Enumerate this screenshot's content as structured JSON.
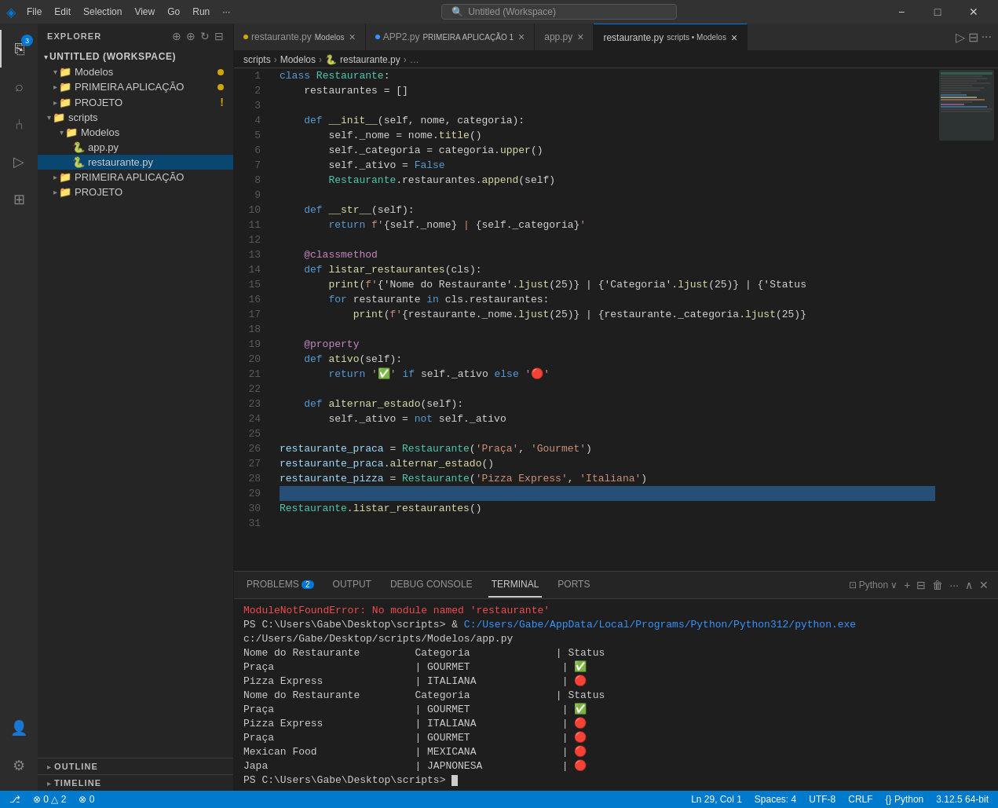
{
  "titlebar": {
    "logo": "◈",
    "menu_items": [
      "File",
      "Edit",
      "Selection",
      "View",
      "Go",
      "Run",
      "···"
    ],
    "search_placeholder": "Untitled (Workspace)",
    "controls": [
      "⧉",
      "⊡",
      "❐",
      "⊞",
      "−",
      "□",
      "✕"
    ]
  },
  "activity_bar": {
    "icons": [
      {
        "name": "explorer-icon",
        "symbol": "⎘",
        "badge": "3",
        "has_badge": true
      },
      {
        "name": "search-icon",
        "symbol": "🔍",
        "has_badge": false
      },
      {
        "name": "source-control-icon",
        "symbol": "⑃",
        "has_badge": false
      },
      {
        "name": "run-icon",
        "symbol": "▷",
        "has_badge": false
      },
      {
        "name": "extensions-icon",
        "symbol": "⊞",
        "has_badge": false
      }
    ],
    "bottom_icons": [
      {
        "name": "account-icon",
        "symbol": "👤"
      },
      {
        "name": "settings-icon",
        "symbol": "⚙"
      }
    ]
  },
  "sidebar": {
    "title": "EXPLORER",
    "workspace": "UNTITLED (WORKSPACE)",
    "tree": [
      {
        "label": "Modelos",
        "indent": 1,
        "type": "folder",
        "expanded": true,
        "dot": "yellow"
      },
      {
        "label": "PRIMEIRA APLICAÇÃO",
        "indent": 1,
        "type": "folder",
        "expanded": false,
        "dot": "yellow"
      },
      {
        "label": "PROJETO",
        "indent": 1,
        "type": "folder",
        "expanded": false,
        "dot": "warning"
      },
      {
        "label": "scripts",
        "indent": 0,
        "type": "folder",
        "expanded": true
      },
      {
        "label": "Modelos",
        "indent": 2,
        "type": "folder",
        "expanded": true
      },
      {
        "label": "app.py",
        "indent": 3,
        "type": "file-py"
      },
      {
        "label": "restaurante.py",
        "indent": 3,
        "type": "file-py",
        "active": true
      },
      {
        "label": "PRIMEIRA APLICAÇÃO",
        "indent": 1,
        "type": "folder",
        "expanded": false
      },
      {
        "label": "PROJETO",
        "indent": 1,
        "type": "folder",
        "expanded": false
      }
    ]
  },
  "tabs": [
    {
      "label": "restaurante.py",
      "group": "APP2.py",
      "dot": "yellow",
      "active": false,
      "group_label": "Modelos"
    },
    {
      "label": "APP2.py",
      "group_label": "PRIMEIRA APLICAÇÃO 1",
      "dot": "blue",
      "active": false
    },
    {
      "label": "app.py",
      "active": false
    },
    {
      "label": "restaurante.py",
      "group_label": "scripts • Modelos",
      "active": true,
      "closeable": true
    }
  ],
  "breadcrumb": {
    "parts": [
      "scripts",
      "Modelos",
      "restaurante.py",
      "…"
    ]
  },
  "code": {
    "lines": [
      {
        "n": 1,
        "text": "class Restaurante:"
      },
      {
        "n": 2,
        "text": "    restaurantes = []"
      },
      {
        "n": 3,
        "text": ""
      },
      {
        "n": 4,
        "text": "    def __init__(self, nome, categoria):"
      },
      {
        "n": 5,
        "text": "        self._nome = nome.title()"
      },
      {
        "n": 6,
        "text": "        self._categoria = categoria.upper()"
      },
      {
        "n": 7,
        "text": "        self._ativo = False"
      },
      {
        "n": 8,
        "text": "        Restaurante.restaurantes.append(self)"
      },
      {
        "n": 9,
        "text": ""
      },
      {
        "n": 10,
        "text": "    def __str__(self):"
      },
      {
        "n": 11,
        "text": "        return f'{self._nome} | {self._categoria}'"
      },
      {
        "n": 12,
        "text": ""
      },
      {
        "n": 13,
        "text": "    @classmethod"
      },
      {
        "n": 14,
        "text": "    def listar_restaurantes(cls):"
      },
      {
        "n": 15,
        "text": "        print(f'{'Nome do Restaurante'.ljust(25)} | {'Categoria'.ljust(25)} | {'Status"
      },
      {
        "n": 16,
        "text": "        for restaurante in cls.restaurantes:"
      },
      {
        "n": 17,
        "text": "            print(f'{restaurante._nome.ljust(25)} | {restaurante._categoria.ljust(25)}"
      },
      {
        "n": 18,
        "text": ""
      },
      {
        "n": 19,
        "text": "    @property"
      },
      {
        "n": 20,
        "text": "    def ativo(self):"
      },
      {
        "n": 21,
        "text": "        return '✅' if self._ativo else '🔴'"
      },
      {
        "n": 22,
        "text": ""
      },
      {
        "n": 23,
        "text": "    def alternar_estado(self):"
      },
      {
        "n": 24,
        "text": "        self._ativo = not self._ativo"
      },
      {
        "n": 25,
        "text": ""
      },
      {
        "n": 26,
        "text": "restaurante_praca = Restaurante('Praça', 'Gourmet')"
      },
      {
        "n": 27,
        "text": "restaurante_praca.alternar_estado()"
      },
      {
        "n": 28,
        "text": "restaurante_pizza = Restaurante('Pizza Express', 'Italiana')"
      },
      {
        "n": 29,
        "text": ""
      },
      {
        "n": 30,
        "text": "Restaurante.listar_restaurantes()"
      },
      {
        "n": 31,
        "text": ""
      }
    ]
  },
  "panel": {
    "tabs": [
      {
        "label": "PROBLEMS",
        "badge": "2",
        "active": false
      },
      {
        "label": "OUTPUT",
        "active": false
      },
      {
        "label": "DEBUG CONSOLE",
        "active": false
      },
      {
        "label": "TERMINAL",
        "active": true
      },
      {
        "label": "PORTS",
        "active": false
      }
    ],
    "controls": {
      "python_label": "Python",
      "add": "+",
      "split": "⊟",
      "trash": "🗑",
      "more": "···",
      "chevron_up": "∧",
      "close": "✕"
    },
    "terminal_lines": [
      {
        "text": "ModuleNotFoundError: No module named 'restaurante'",
        "color": "error"
      },
      {
        "text": "PS C:\\Users\\Gabe\\Desktop\\scripts> & C:/Users/Gabe/AppData/Local/Programs/Python/Python312/python.exe  c:/Users/Gabe/Desktop/scripts/Modelos/app.py",
        "color": "cmd"
      },
      {
        "text": "Nome do Restaurante         Categoria              | Status",
        "color": "data"
      },
      {
        "text": "Praça                       | GOURMET               | ✅",
        "color": "data"
      },
      {
        "text": "Pizza Express               | ITALIANA              | 🔴",
        "color": "data"
      },
      {
        "text": "Nome do Restaurante         Categoria              | Status",
        "color": "data"
      },
      {
        "text": "Praça                       | GOURMET               | ✅",
        "color": "data"
      },
      {
        "text": "Pizza Express               | ITALIANA              | 🔴",
        "color": "data"
      },
      {
        "text": "Praça                       | GOURMET               | 🔴",
        "color": "data"
      },
      {
        "text": "Mexican Food                | MEXICANA              | 🔴",
        "color": "data"
      },
      {
        "text": "Japa                        | JAPNONESA             | 🔴",
        "color": "data"
      },
      {
        "text": "PS C:\\Users\\Gabe\\Desktop\\scripts> ",
        "color": "prompt"
      }
    ]
  },
  "statusbar": {
    "left": [
      "⎇",
      "0 △ 2",
      "⊗ 0"
    ],
    "right": [
      "Ln 29, Col 1",
      "Spaces: 4",
      "UTF-8",
      "CRLF",
      "{} Python",
      "3.12.5 64-bit"
    ]
  }
}
